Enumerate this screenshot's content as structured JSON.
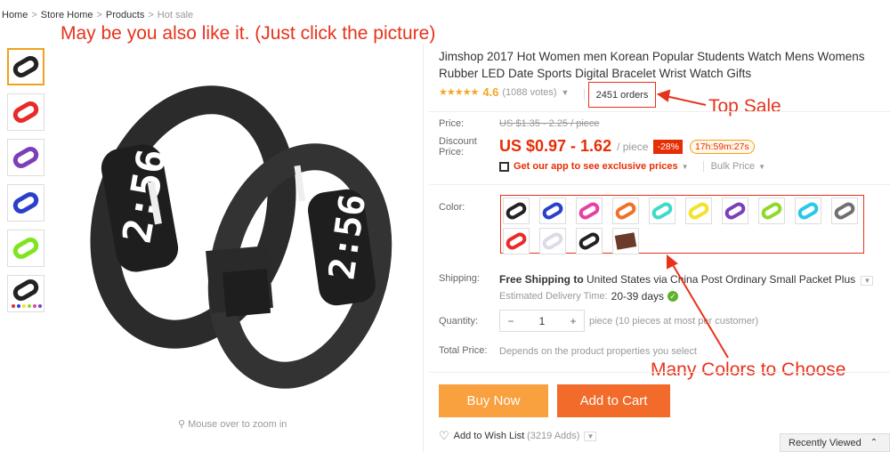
{
  "breadcrumb": {
    "items": [
      "Home",
      "Store Home",
      "Products",
      "Hot sale"
    ],
    "separator": ">"
  },
  "promo_note": "May be you also like it. (Just click the picture)",
  "gallery": {
    "thumbnail_colors": [
      "#222222",
      "#e82a2a",
      "#7b3fb8",
      "#2a3fcc",
      "#7ee51f",
      "#222222"
    ],
    "zoom_hint": "Mouse over to zoom in",
    "zoom_icon": "magnifier-icon"
  },
  "product": {
    "title": "Jimshop 2017 Hot Women men Korean Popular Students Watch Mens Womens Rubber LED Date Sports Digital Bracelet Wrist Watch Gifts",
    "stars": "★★★★★",
    "rating": "4.6",
    "votes": "(1088 votes)",
    "orders": "2451 orders"
  },
  "callouts": {
    "top_sale": "Top Sale",
    "many_colors": "Many Colors to Choose"
  },
  "pricing": {
    "price_label": "Price:",
    "original_price": "US $1.35 - 2.25 / piece",
    "discount_label": "Discount\nPrice:",
    "discount_price": "US $0.97 - 1.62",
    "per_unit": "/ piece",
    "discount_badge": "-28%",
    "countdown": "17h:59m:27s",
    "app_promo": "Get our app to see exclusive prices",
    "bulk_price": "Bulk Price"
  },
  "color": {
    "label": "Color:",
    "swatches": [
      {
        "name": "black",
        "hex": "#222222"
      },
      {
        "name": "blue",
        "hex": "#2a3fcc"
      },
      {
        "name": "pink",
        "hex": "#e83fa6"
      },
      {
        "name": "orange",
        "hex": "#f2702a"
      },
      {
        "name": "cyan",
        "hex": "#3fd9c8"
      },
      {
        "name": "yellow",
        "hex": "#f2e32a"
      },
      {
        "name": "purple",
        "hex": "#7b3fb8"
      },
      {
        "name": "green",
        "hex": "#8fd92a"
      },
      {
        "name": "sky",
        "hex": "#2ac8e8"
      },
      {
        "name": "gray",
        "hex": "#707070"
      },
      {
        "name": "red",
        "hex": "#e82a2a"
      },
      {
        "name": "white",
        "hex": "#dcdce8"
      },
      {
        "name": "black-white",
        "hex": "#222222"
      },
      {
        "name": "gift-box",
        "hex": "#6b3a2a"
      }
    ]
  },
  "shipping": {
    "label": "Shipping:",
    "method_bold": "Free Shipping to",
    "method_rest": " United States via China Post Ordinary Small Packet Plus",
    "delivery_label": "Estimated Delivery Time:",
    "delivery_days": "20-39 days"
  },
  "quantity": {
    "label": "Quantity:",
    "value": "1",
    "minus": "−",
    "plus": "+",
    "note": "piece (10 pieces at most per customer)"
  },
  "total": {
    "label": "Total Price:",
    "note": "Depends on the product properties you select"
  },
  "actions": {
    "buy_now": "Buy Now",
    "add_to_cart": "Add to Cart",
    "wish_list": "Add to Wish List",
    "wish_count": "(3219 Adds)"
  },
  "recently_viewed": "Recently Viewed",
  "colors": {
    "accent_red": "#e62e04",
    "annotation_red": "#e8321c",
    "buy_orange": "#f9a03f",
    "cart_orange": "#f26b2a",
    "star_gold": "#f5a623"
  }
}
